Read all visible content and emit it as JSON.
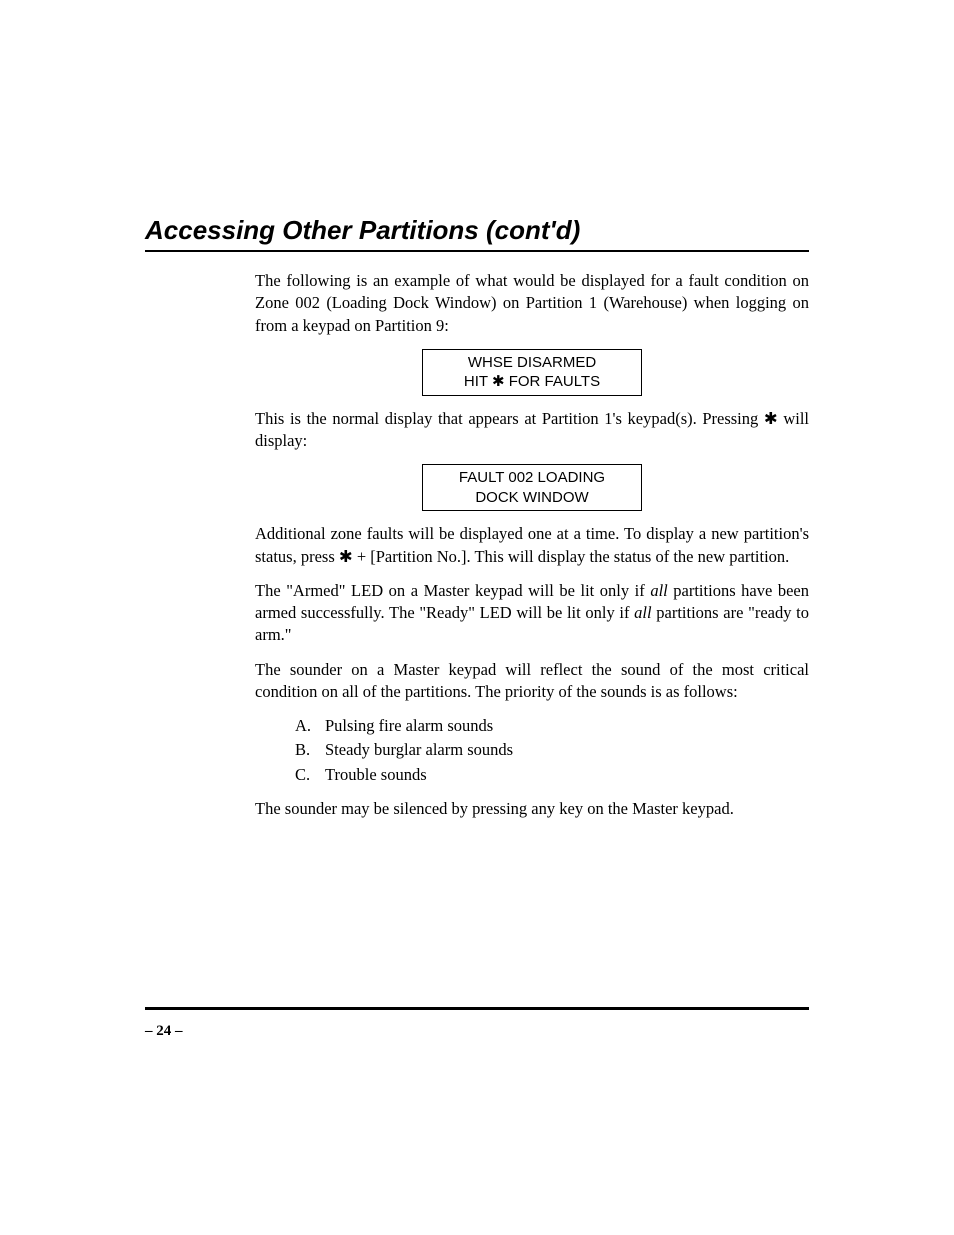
{
  "heading": "Accessing Other Partitions (cont'd)",
  "para1": "The following is an example of what would be displayed for a fault condition on Zone 002 (Loading Dock Window) on Partition 1 (Warehouse) when logging on from a keypad on Partition 9:",
  "display1_line1": "WHSE DISARMED",
  "display1_line2_pre": "HIT ",
  "display1_line2_post": " FOR FAULTS",
  "para2_pre": "This is the normal display that appears at Partition 1's keypad(s). Pressing ",
  "para2_post": " will display:",
  "display2_line1": "FAULT 002 LOADING",
  "display2_line2": "DOCK WINDOW",
  "para3_pre": "Additional zone faults will be displayed one at a time.  To display a new partition's status, press ",
  "para3_post": " + [Partition No.].  This will display the status of the new partition.",
  "para4_a": "The \"Armed\" LED on a Master keypad will be lit only if ",
  "para4_all1": "all",
  "para4_b": " partitions have been armed successfully.  The \"Ready\" LED will be lit only if ",
  "para4_all2": "all",
  "para4_c": " partitions are \"ready to arm.\"",
  "para5": "The sounder on a Master keypad will reflect the sound of the most critical condition on all of the partitions.  The priority of the sounds is as follows:",
  "list": {
    "a_marker": "A.",
    "a_text": "Pulsing fire alarm sounds",
    "b_marker": "B.",
    "b_text": "Steady burglar alarm sounds",
    "c_marker": "C.",
    "c_text": "Trouble sounds"
  },
  "para6": "The sounder may be silenced by pressing any key on the Master keypad.",
  "star": "✱",
  "page_number": "– 24 –"
}
